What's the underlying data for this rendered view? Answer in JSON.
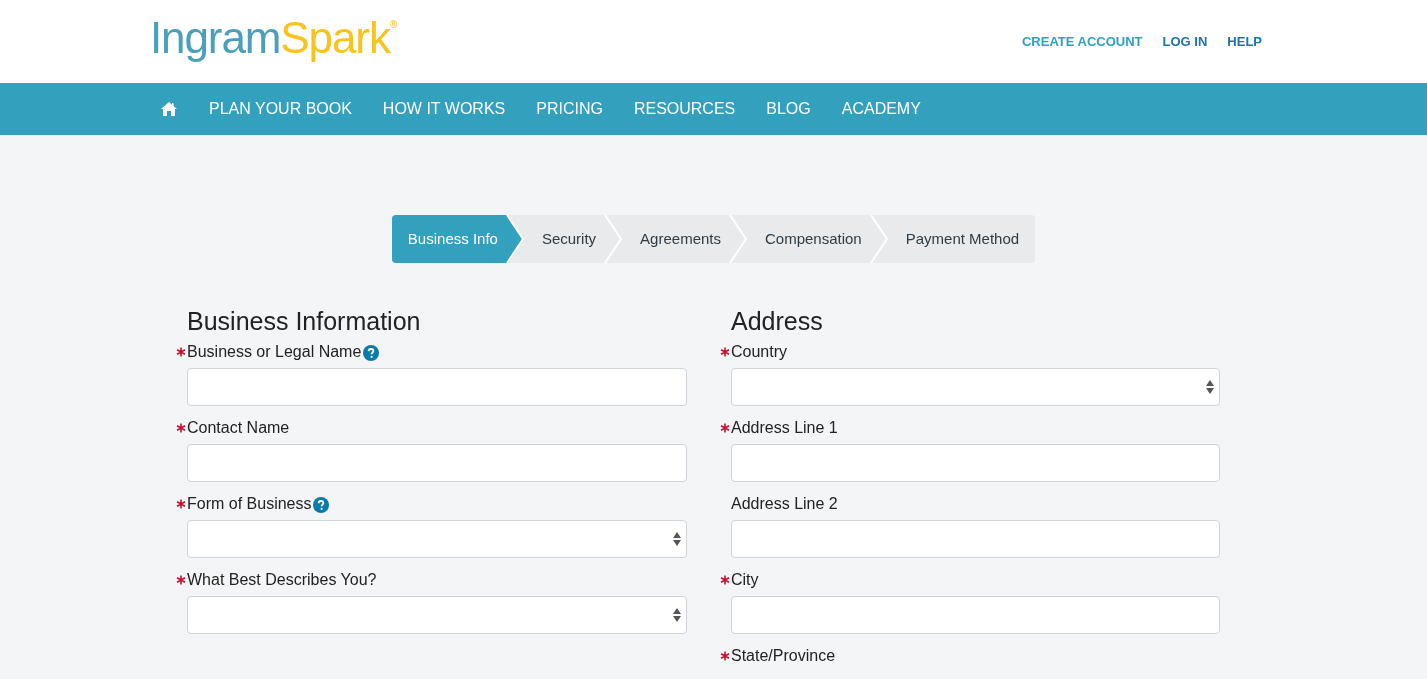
{
  "logo": {
    "first": "Ingram",
    "second": "Spark",
    "mark": "®"
  },
  "top_links": [
    "CREATE ACCOUNT",
    "LOG IN",
    "HELP"
  ],
  "nav": [
    "PLAN YOUR BOOK",
    "HOW IT WORKS",
    "PRICING",
    "RESOURCES",
    "BLOG",
    "ACADEMY"
  ],
  "steps": [
    {
      "label": "Business Info",
      "selected": true
    },
    {
      "label": "Security",
      "selected": false
    },
    {
      "label": "Agreements",
      "selected": false
    },
    {
      "label": "Compensation",
      "selected": false
    },
    {
      "label": "Payment Method",
      "selected": false
    }
  ],
  "sections": [
    {
      "title": "Business Information",
      "fields": [
        {
          "label": "Business or Legal Name",
          "required": true,
          "help": true,
          "kind": "text"
        },
        {
          "label": "Contact Name",
          "required": true,
          "kind": "text"
        },
        {
          "label": "Form of Business",
          "required": true,
          "help": true,
          "kind": "select"
        },
        {
          "label": "What Best Describes You?",
          "required": true,
          "kind": "select"
        }
      ]
    },
    {
      "title": "Address",
      "fields": [
        {
          "label": "Country",
          "required": true,
          "kind": "select"
        },
        {
          "label": "Address Line 1",
          "required": true,
          "kind": "text"
        },
        {
          "label": "Address Line 2",
          "required": false,
          "kind": "text"
        },
        {
          "label": "City",
          "required": true,
          "kind": "text"
        },
        {
          "label": "State/Province",
          "required": true,
          "kind": "label"
        }
      ]
    }
  ]
}
